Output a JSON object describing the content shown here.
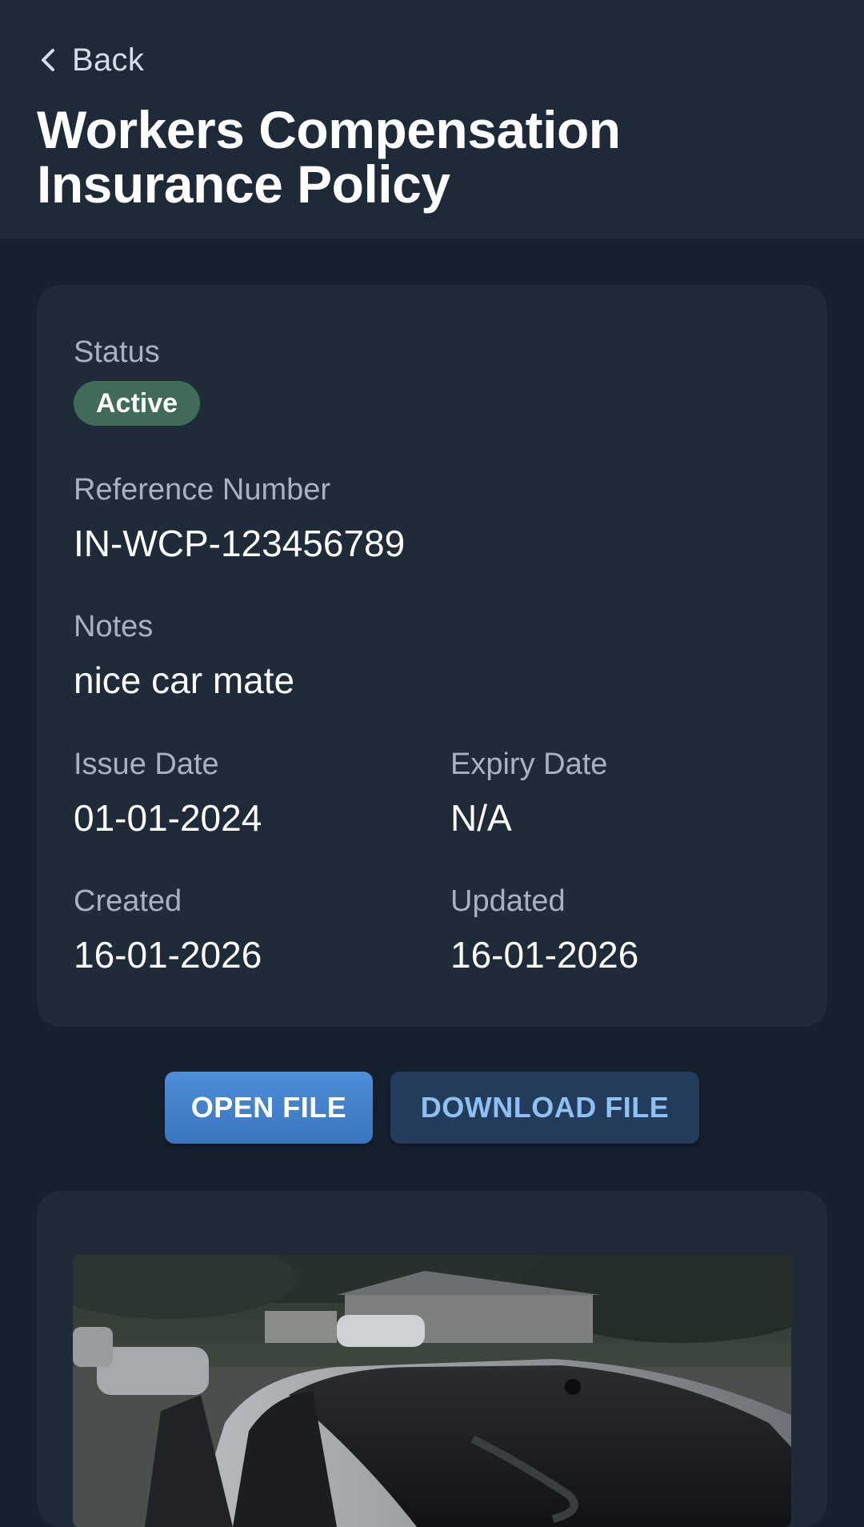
{
  "header": {
    "back_label": "Back",
    "title": "Workers Compensation Insurance Policy"
  },
  "details": {
    "status_label": "Status",
    "status_value": "Active",
    "reference_label": "Reference Number",
    "reference_value": "IN-WCP-123456789",
    "notes_label": "Notes",
    "notes_value": "nice car mate",
    "issue_date_label": "Issue Date",
    "issue_date_value": "01-01-2024",
    "expiry_date_label": "Expiry Date",
    "expiry_date_value": "N/A",
    "created_label": "Created",
    "created_value": "16-01-2026",
    "updated_label": "Updated",
    "updated_value": "16-01-2026"
  },
  "actions": {
    "open_label": "OPEN FILE",
    "download_label": "DOWNLOAD FILE"
  },
  "icons": {
    "back": "chevron-left-icon"
  },
  "colors": {
    "status_active": "#3f6b57",
    "primary_button": "#4482cc",
    "secondary_button": "#233c5c"
  }
}
